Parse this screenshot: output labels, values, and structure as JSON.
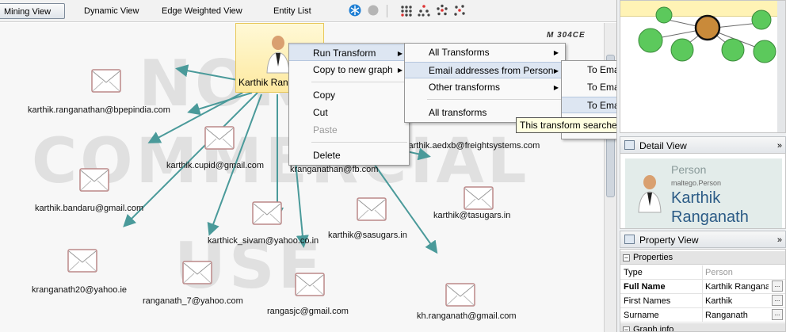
{
  "toolbar": {
    "tabs": [
      "Mining View",
      "Dynamic View",
      "Edge Weighted View",
      "Entity List"
    ]
  },
  "brand": "M 304CE",
  "graph": {
    "watermark_lines": [
      "NON",
      "COMMERCIAL",
      "USE"
    ],
    "person_label": "Karthik Ranganathan",
    "emails": [
      "karthik.ranganathan@bpepindia.com",
      "karthik.cupid@gmail.com",
      "kranganathan@fb.com",
      "karthik.aedxb@freightsystems.com",
      "karthik.bandaru@gmail.com",
      "karthick_sivam@yahoo.co.in",
      "karthik@sasugars.in",
      "karthik@tasugars.in",
      "kranganath20@yahoo.ie",
      "ranganath_7@yahoo.com",
      "rangasjc@gmail.com",
      "kh.ranganath@gmail.com"
    ]
  },
  "context_menu": {
    "items": [
      "Run Transform",
      "Copy to new graph",
      "Copy",
      "Cut",
      "Paste",
      "Delete"
    ]
  },
  "transform_menu": {
    "items": [
      "All Transforms",
      "Email addresses from Person",
      "Other transforms",
      "All transforms"
    ]
  },
  "email_menu": {
    "items": [
      "To Email Address [PGP]",
      "To Email Address [Verify common]",
      "To Email Address [using Search Engine]"
    ]
  },
  "tooltip": "This transform searches for the person's most likely email address",
  "detail_view": {
    "title": "Detail View",
    "type": "Person",
    "kind": "maltego.Person",
    "name": "Karthik Ranganath"
  },
  "property_view": {
    "title": "Property View",
    "group_properties": "Properties",
    "group_graph": "Graph info",
    "rows": [
      {
        "key": "Type",
        "value": "Person"
      },
      {
        "key": "Full Name",
        "value": "Karthik Ranganathan"
      },
      {
        "key": "First Names",
        "value": "Karthik"
      },
      {
        "key": "Surname",
        "value": "Ranganath"
      }
    ]
  },
  "colors": {
    "edge": "#4a9a9a",
    "highlight": "#dde6f2",
    "node_bg": "#fde9a0",
    "tooltip_bg": "#ffffe1"
  }
}
